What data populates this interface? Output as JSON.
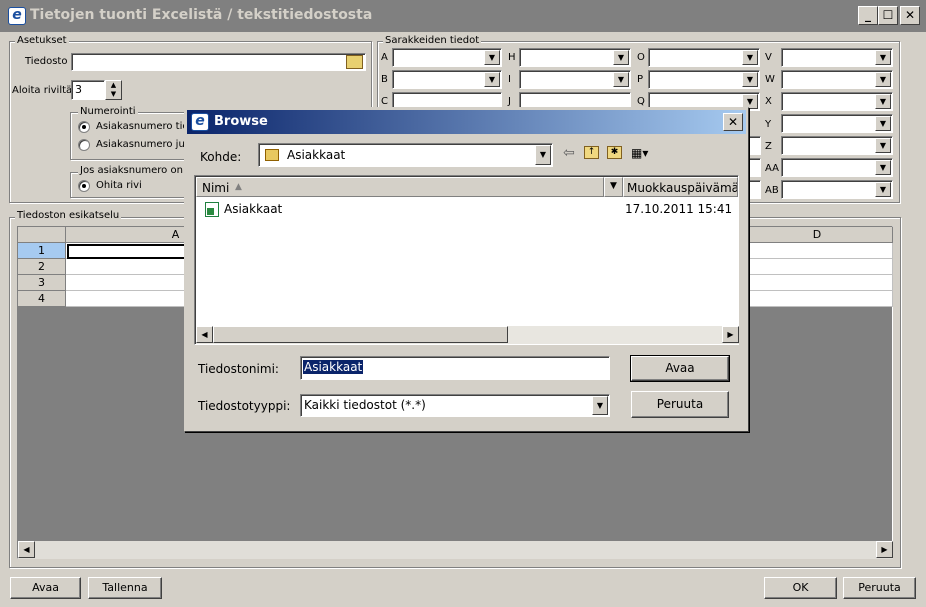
{
  "window": {
    "title": "Tietojen tuonti Excelistä / tekstitiedostosta",
    "minimize": "_",
    "maximize": "☐",
    "close": "✕"
  },
  "settings": {
    "legend": "Asetukset",
    "file_label": "Tiedosto",
    "file_value": "",
    "start_row_label": "Aloita riviltä",
    "start_row_value": "3",
    "numbering_legend": "Numerointi",
    "numbering_options": [
      "Asiakasnumero tie",
      "Asiakasnumero ju"
    ],
    "exists_legend": "Jos asiaksnumero on",
    "exists_option": "Ohita rivi"
  },
  "columns": {
    "legend": "Sarakkeiden tiedot",
    "col1": [
      "A",
      "B",
      "C"
    ],
    "col2": [
      "H",
      "I",
      "J"
    ],
    "col3": [
      "O",
      "P",
      "Q"
    ],
    "col4": [
      "V",
      "W",
      "X",
      "Y",
      "Z",
      "AA",
      "AB"
    ]
  },
  "preview": {
    "legend": "Tiedoston esikatselu",
    "col_headers": [
      "A",
      "D"
    ],
    "row_headers": [
      "1",
      "2",
      "3",
      "4"
    ]
  },
  "footer": {
    "open": "Avaa",
    "save": "Tallenna",
    "ok": "OK",
    "cancel": "Peruuta"
  },
  "dialog": {
    "title": "Browse",
    "look_in_label": "Kohde:",
    "look_in_value": "Asiakkaat",
    "col_name": "Nimi",
    "col_modified": "Muokkauspäivämä",
    "file_name": "Asiakkaat",
    "file_date": "17.10.2011 15:41",
    "filename_label": "Tiedostonimi:",
    "filename_value": "Asiakkaat",
    "filetype_label": "Tiedostotyyppi:",
    "filetype_value": "Kaikki tiedostot (*.*)",
    "open_button": "Avaa",
    "cancel_button": "Peruuta"
  }
}
